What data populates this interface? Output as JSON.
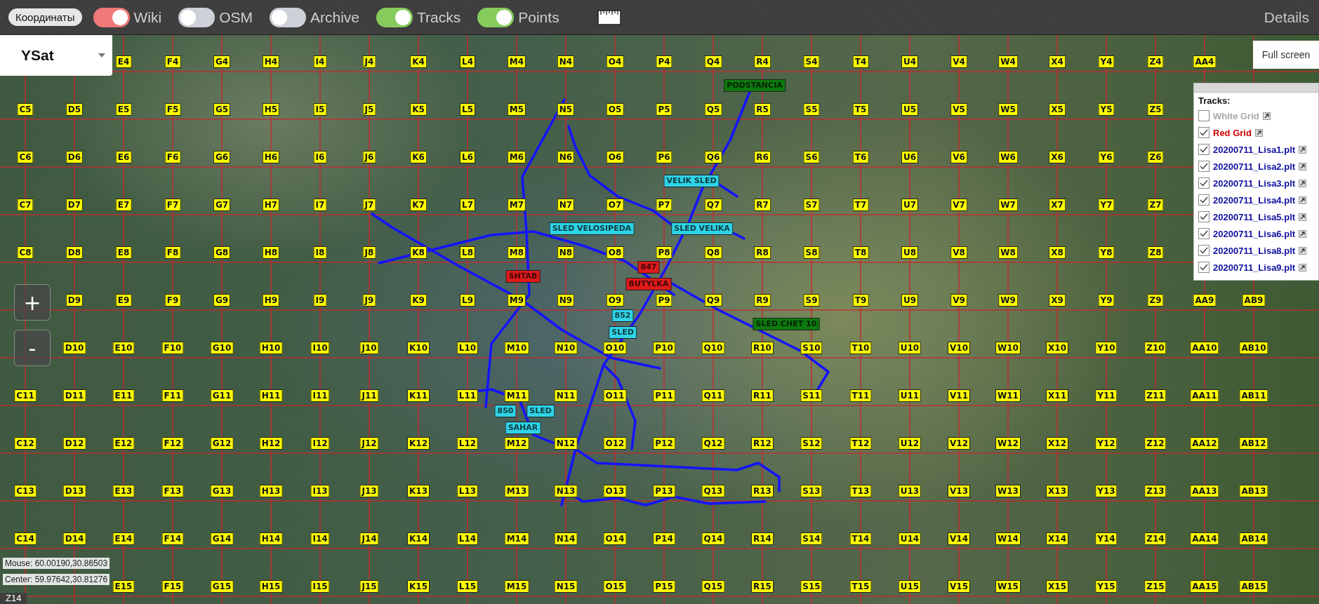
{
  "toolbar": {
    "coordinates_button": "Координаты",
    "toggles": [
      {
        "label": "Wiki",
        "on": true,
        "color": "#f07878"
      },
      {
        "label": "OSM",
        "on": false
      },
      {
        "label": "Archive",
        "on": false
      },
      {
        "label": "Tracks",
        "on": true,
        "color": "#86cc5c"
      },
      {
        "label": "Points",
        "on": true,
        "color": "#86cc5c"
      }
    ],
    "details": "Details"
  },
  "map": {
    "layer_select": {
      "value": "YSat"
    },
    "zoom_in": "+",
    "zoom_out": "-",
    "fullscreen_button": "Full screen",
    "grid_labels": [
      {
        "kind": "from_e",
        "labels": [
          "E4",
          "F4",
          "G4",
          "H4",
          "I4",
          "J4",
          "K4",
          "L4",
          "M4",
          "N4",
          "O4",
          "P4",
          "Q4",
          "R4",
          "S4",
          "T4",
          "U4",
          "V4",
          "W4",
          "X4",
          "Y4",
          "Z4",
          "AA4"
        ]
      },
      {
        "kind": "from_c",
        "labels": [
          "C5",
          "D5",
          "E5",
          "F5",
          "G5",
          "H5",
          "I5",
          "J5",
          "K5",
          "L5",
          "M5",
          "N5",
          "O5",
          "P5",
          "Q5",
          "R5",
          "S5",
          "T5",
          "U5",
          "V5",
          "W5",
          "X5",
          "Y5",
          "Z5"
        ]
      },
      {
        "kind": "from_c",
        "labels": [
          "C6",
          "D6",
          "E6",
          "F6",
          "G6",
          "H6",
          "I6",
          "J6",
          "K6",
          "L6",
          "M6",
          "N6",
          "O6",
          "P6",
          "Q6",
          "R6",
          "S6",
          "T6",
          "U6",
          "V6",
          "W6",
          "X6",
          "Y6",
          "Z6"
        ]
      },
      {
        "kind": "from_c",
        "labels": [
          "C7",
          "D7",
          "E7",
          "F7",
          "G7",
          "H7",
          "I7",
          "J7",
          "K7",
          "L7",
          "M7",
          "N7",
          "O7",
          "P7",
          "Q7",
          "R7",
          "S7",
          "T7",
          "U7",
          "V7",
          "W7",
          "X7",
          "Y7",
          "Z7"
        ]
      },
      {
        "kind": "from_c",
        "labels": [
          "C8",
          "D8",
          "E8",
          "F8",
          "G8",
          "H8",
          "I8",
          "J8",
          "K8",
          "L8",
          "M8",
          "N8",
          "O8",
          "P8",
          "Q8",
          "R8",
          "S8",
          "T8",
          "U8",
          "V8",
          "W8",
          "X8",
          "Y8",
          "Z8"
        ]
      },
      {
        "kind": "from_d",
        "labels": [
          "D9",
          "E9",
          "F9",
          "G9",
          "H9",
          "I9",
          "J9",
          "K9",
          "L9",
          "M9",
          "N9",
          "O9",
          "P9",
          "Q9",
          "R9",
          "S9",
          "T9",
          "U9",
          "V9",
          "W9",
          "X9",
          "Y9",
          "Z9",
          "AA9",
          "AB9"
        ]
      },
      {
        "kind": "from_d",
        "labels": [
          "D10",
          "E10",
          "F10",
          "G10",
          "H10",
          "I10",
          "J10",
          "K10",
          "L10",
          "M10",
          "N10",
          "O10",
          "P10",
          "Q10",
          "R10",
          "S10",
          "T10",
          "U10",
          "V10",
          "W10",
          "X10",
          "Y10",
          "Z10",
          "AA10",
          "AB10"
        ]
      },
      {
        "kind": "from_c",
        "labels": [
          "C11",
          "D11",
          "E11",
          "F11",
          "G11",
          "H11",
          "I11",
          "J11",
          "K11",
          "L11",
          "M11",
          "N11",
          "O11",
          "P11",
          "Q11",
          "R11",
          "S11",
          "T11",
          "U11",
          "V11",
          "W11",
          "X11",
          "Y11",
          "Z11",
          "AA11",
          "AB11"
        ]
      },
      {
        "kind": "from_c",
        "labels": [
          "C12",
          "D12",
          "E12",
          "F12",
          "G12",
          "H12",
          "I12",
          "J12",
          "K12",
          "L12",
          "M12",
          "N12",
          "O12",
          "P12",
          "Q12",
          "R12",
          "S12",
          "T12",
          "U12",
          "V12",
          "W12",
          "X12",
          "Y12",
          "Z12",
          "AA12",
          "AB12"
        ]
      },
      {
        "kind": "from_c",
        "labels": [
          "C13",
          "D13",
          "E13",
          "F13",
          "G13",
          "H13",
          "I13",
          "J13",
          "K13",
          "L13",
          "M13",
          "N13",
          "O13",
          "P13",
          "Q13",
          "R13",
          "S13",
          "T13",
          "U13",
          "V13",
          "W13",
          "X13",
          "Y13",
          "Z13",
          "AA13",
          "AB13"
        ]
      },
      {
        "kind": "from_c",
        "labels": [
          "C14",
          "D14",
          "E14",
          "F14",
          "G14",
          "H14",
          "I14",
          "J14",
          "K14",
          "L14",
          "M14",
          "N14",
          "O14",
          "P14",
          "Q14",
          "R14",
          "S14",
          "T14",
          "U14",
          "V14",
          "W14",
          "X14",
          "Y14",
          "Z14",
          "AA14",
          "AB14"
        ]
      },
      {
        "kind": "from_e",
        "labels": [
          "E15",
          "F15",
          "G15",
          "H15",
          "I15",
          "J15",
          "K15",
          "L15",
          "M15",
          "N15",
          "O15",
          "P15",
          "Q15",
          "R15",
          "S15",
          "T15",
          "U15",
          "V15",
          "W15",
          "X15",
          "Y15",
          "Z15",
          "AA15",
          "AB15"
        ]
      }
    ],
    "waypoints": [
      {
        "text": "PODSTANCIA",
        "color": "#0e7a0e"
      },
      {
        "text": "VELIK SLED",
        "color": "#2ed3e6"
      },
      {
        "text": "SLED VELOSIPEDA",
        "color": "#2ed3e6"
      },
      {
        "text": "SLED VELIKA",
        "color": "#2ed3e6"
      },
      {
        "text": "847",
        "color": "#e01a1a"
      },
      {
        "text": "SHTAB",
        "color": "#e01a1a"
      },
      {
        "text": "BUTYLKA",
        "color": "#e01a1a"
      },
      {
        "text": "852",
        "color": "#2ed3e6"
      },
      {
        "text": "SLED",
        "color": "#2ed3e6"
      },
      {
        "text": "SLED CHET 10",
        "color": "#0e7a0e"
      },
      {
        "text": "850",
        "color": "#2ed3e6"
      },
      {
        "text": "SLED",
        "color": "#2ed3e6"
      },
      {
        "text": "SAHAR",
        "color": "#2ed3e6"
      }
    ],
    "mouse": "Mouse: 60.00190,30.86503",
    "center": "Center: 59.97642,30.81276",
    "zoom_level": "Z14"
  },
  "tracks_panel": {
    "title": "Tracks:",
    "items": [
      {
        "label": "White Grid",
        "checked": false,
        "color": "#a8a8a8"
      },
      {
        "label": "Red Grid",
        "checked": true,
        "color": "#d00000"
      },
      {
        "label": "20200711_Lisa1.plt",
        "checked": true,
        "color": "#1010a0"
      },
      {
        "label": "20200711_Lisa2.plt",
        "checked": true,
        "color": "#1010a0"
      },
      {
        "label": "20200711_Lisa3.plt",
        "checked": true,
        "color": "#1010a0"
      },
      {
        "label": "20200711_Lisa4.plt",
        "checked": true,
        "color": "#1010a0"
      },
      {
        "label": "20200711_Lisa5.plt",
        "checked": true,
        "color": "#1010a0"
      },
      {
        "label": "20200711_Lisa6.plt",
        "checked": true,
        "color": "#1010a0"
      },
      {
        "label": "20200711_Lisa8.plt",
        "checked": true,
        "color": "#1010a0"
      },
      {
        "label": "20200711_Lisa9.plt",
        "checked": true,
        "color": "#1010a0"
      }
    ]
  }
}
